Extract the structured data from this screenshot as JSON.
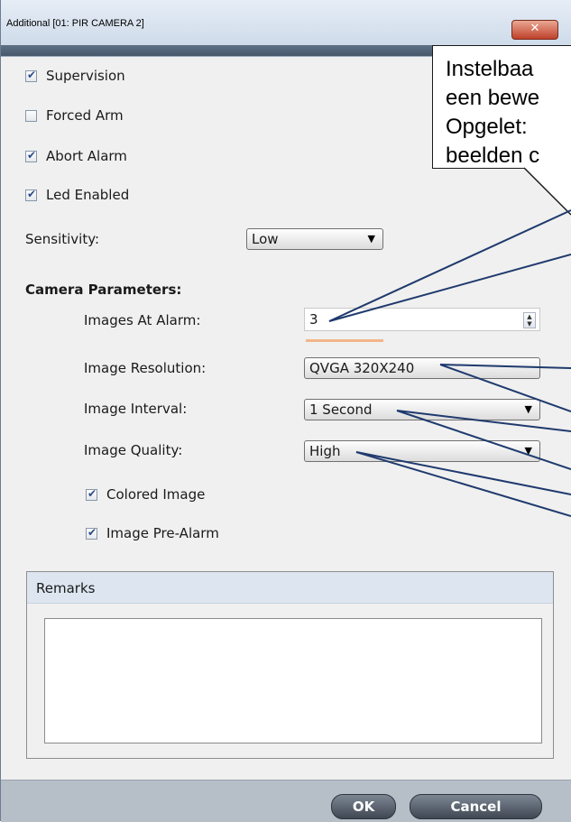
{
  "window": {
    "title": "Additional [01: PIR CAMERA 2]",
    "close_glyph": "✕"
  },
  "options": [
    {
      "label": "Supervision",
      "checked": true
    },
    {
      "label": "Forced Arm",
      "checked": false
    },
    {
      "label": "Abort Alarm",
      "checked": true
    },
    {
      "label": "Led Enabled",
      "checked": true
    }
  ],
  "sensitivity": {
    "label": "Sensitivity:",
    "value": "Low"
  },
  "camera": {
    "heading": "Camera Parameters:",
    "images_at_alarm": {
      "label": "Images At Alarm:",
      "value": "3"
    },
    "image_resolution": {
      "label": "Image Resolution:",
      "value": "QVGA 320X240"
    },
    "image_interval": {
      "label": "Image Interval:",
      "value": "1 Second"
    },
    "image_quality": {
      "label": "Image Quality:",
      "value": "High"
    },
    "colored_image": {
      "label": "Colored Image",
      "checked": true
    },
    "image_pre_alarm": {
      "label": "Image Pre-Alarm",
      "checked": true
    }
  },
  "remarks": {
    "title": "Remarks",
    "value": ""
  },
  "buttons": {
    "ok": "OK",
    "cancel": "Cancel"
  },
  "annotation": {
    "lines": [
      "Instelbaa",
      "een bewe",
      "Opgelet:",
      "beelden c"
    ],
    "line_color": "#1f3a6e"
  }
}
